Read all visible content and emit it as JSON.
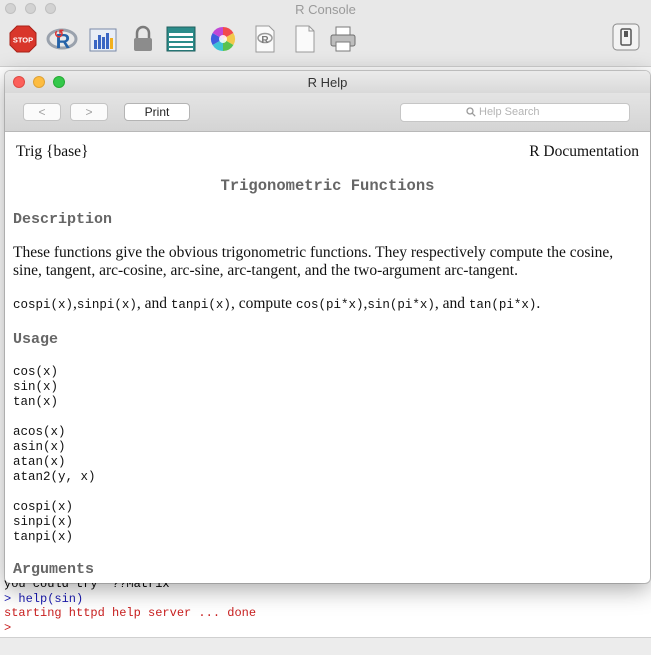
{
  "console": {
    "title": "R Console",
    "toolbar_icons": [
      "stop-icon",
      "r-icon",
      "chart-icon",
      "lock-icon",
      "table-icon",
      "color-wheel-icon",
      "document-r-icon",
      "document-icon",
      "printer-icon",
      "sidebar-toggle-icon"
    ],
    "stop_label": "STOP",
    "lines": [
      {
        "text": "you could try  ??Matrix",
        "color": "#111111"
      },
      {
        "text": "> help(sin)",
        "color": "#1a1ab0"
      },
      {
        "text": "starting httpd help server ... done",
        "color": "#c81e1e"
      },
      {
        "text": ">",
        "color": "#c81e1e"
      }
    ]
  },
  "help": {
    "title": "R Help",
    "back_label": "<",
    "forward_label": ">",
    "print_label": "Print",
    "search_placeholder": "Help Search",
    "doc": {
      "topic": "Trig {base}",
      "doc_label": "R Documentation",
      "title": "Trigonometric Functions",
      "description_heading": "Description",
      "description_text": "These functions give the obvious trigonometric functions. They respectively compute the cosine, sine, tangent, arc-cosine, arc-sine, arc-tangent, and the two-argument arc-tangent.",
      "pi_sentence": {
        "c1": "cospi(x)",
        "s1": ",",
        "c2": "sinpi(x)",
        "s2": ", and",
        "c3": "tanpi(x)",
        "s3": ", compute",
        "c4": "cos(pi*x)",
        "s4": ",",
        "c5": "sin(pi*x)",
        "s5": ", and",
        "c6": "tan(pi*x)",
        "s6": "."
      },
      "usage_heading": "Usage",
      "usage_groups": [
        [
          "cos(x)",
          "sin(x)",
          "tan(x)"
        ],
        [
          "acos(x)",
          "asin(x)",
          "atan(x)",
          "atan2(y, x)"
        ],
        [
          "cospi(x)",
          "sinpi(x)",
          "tanpi(x)"
        ]
      ],
      "arguments_heading": "Arguments"
    }
  },
  "colors": {
    "close": "#fc605b",
    "minimize": "#fdbc40",
    "zoom": "#34c84a"
  }
}
